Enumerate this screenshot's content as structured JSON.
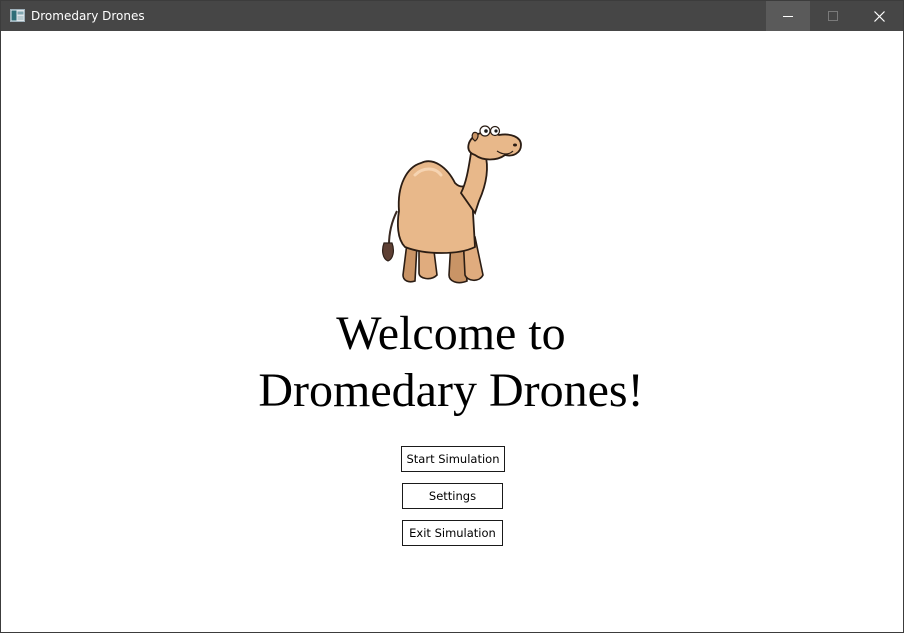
{
  "window": {
    "title": "Dromedary Drones",
    "controls": {
      "minimize_icon": "minimize-icon",
      "maximize_icon": "maximize-icon",
      "close_icon": "close-icon"
    },
    "colors": {
      "titlebar": "#464646",
      "titlebar_text": "#ffffff",
      "content_bg": "#ffffff"
    }
  },
  "main": {
    "logo_icon": "camel-logo",
    "welcome_line1": "Welcome to",
    "welcome_line2": "Dromedary Drones!",
    "buttons": {
      "start": "Start Simulation",
      "settings": "Settings",
      "exit": "Exit Simulation"
    }
  }
}
